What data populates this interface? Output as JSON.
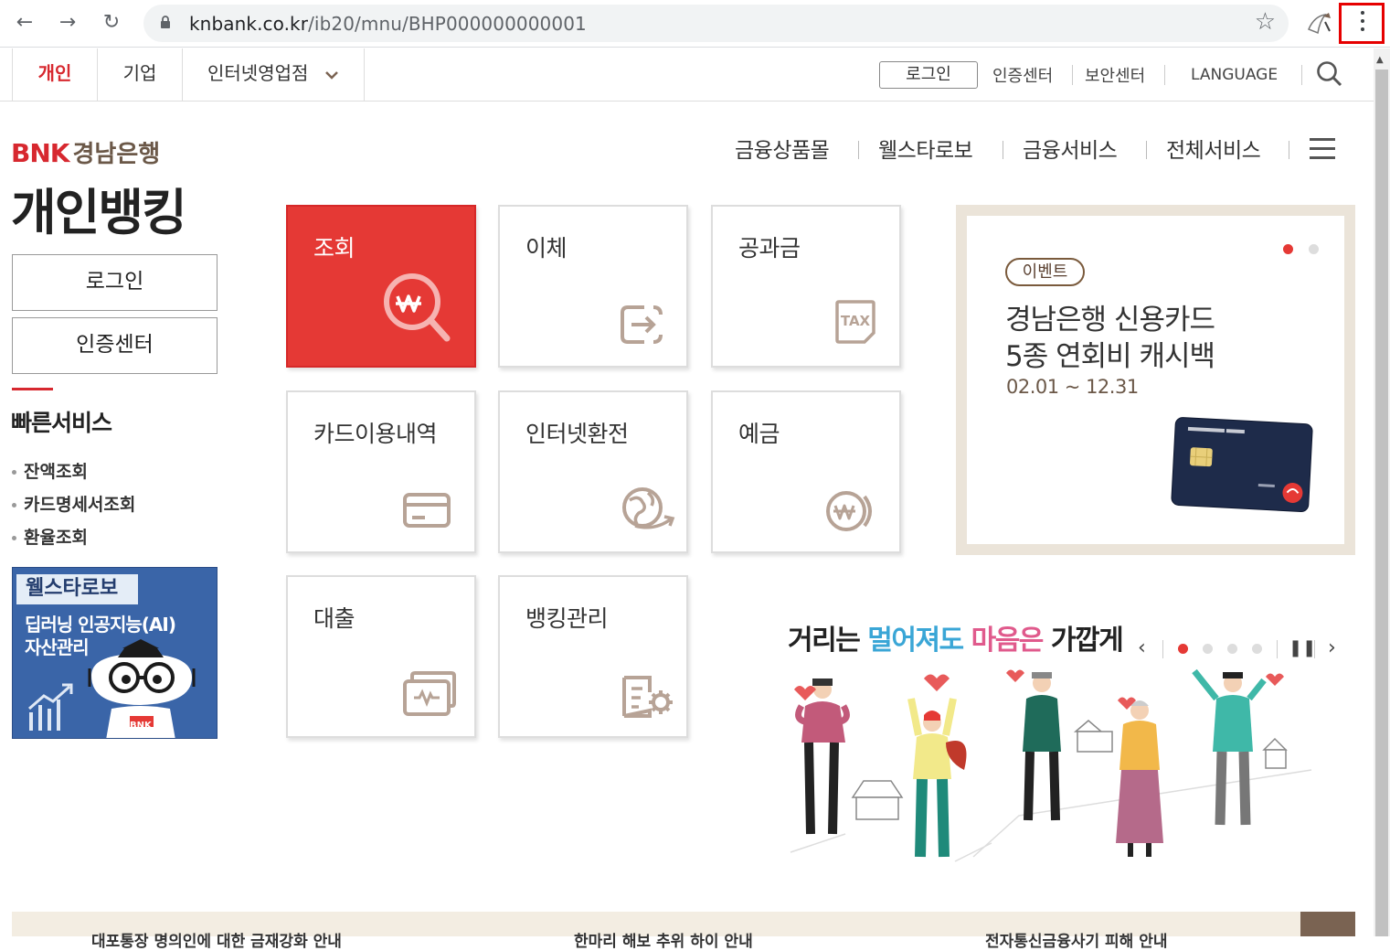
{
  "browser": {
    "url_host": "knbank.co.kr",
    "url_path": "/ib20/mnu/BHP000000000001"
  },
  "topnav": {
    "tabs": [
      {
        "label": "개인"
      },
      {
        "label": "기업"
      },
      {
        "label": "인터넷영업점"
      }
    ],
    "login": "로그인",
    "cert": "인증센터",
    "security": "보안센터",
    "language": "LANGUAGE"
  },
  "logo": {
    "bnk": "BNK",
    "name": "경남은행"
  },
  "page_title": "개인뱅킹",
  "side": {
    "login_button": "로그인",
    "cert_button": "인증센터",
    "quick_title": "빠른서비스",
    "quick_items": [
      "잔액조회",
      "카드명세서조회",
      "환율조회"
    ],
    "robo_tag": "웰스타로보",
    "robo_line1": "딥러닝 인공지능(AI)",
    "robo_line2": "자산관리",
    "robo_brand": "BNK"
  },
  "gnb": [
    "금융상품몰",
    "웰스타로보",
    "금융서비스",
    "전체서비스"
  ],
  "tiles": [
    {
      "label": "조회"
    },
    {
      "label": "이체"
    },
    {
      "label": "공과금"
    },
    {
      "label": "카드이용내역"
    },
    {
      "label": "인터넷환전"
    },
    {
      "label": "예금"
    },
    {
      "label": "대출"
    },
    {
      "label": "뱅킹관리"
    }
  ],
  "tax_icon_text": "TAX",
  "event": {
    "tag": "이벤트",
    "title1": "경남은행 신용카드",
    "title2": "5종 연회비 캐시백",
    "date": "02.01 ~ 12.31"
  },
  "campaign": {
    "part1": "거리는 ",
    "part2": "멀어져도",
    "part3": " ",
    "part4": "마음은",
    "part5": " 가깝게"
  },
  "bottom": [
    "대포통장 명의인에 대한 금재강화 안내",
    "한마리 해보 추위 하이 안내",
    "전자통신금융사기 피해 안내"
  ],
  "colors": {
    "brand_red": "#d7282f",
    "tile_red": "#e53935",
    "brown": "#6b5848"
  }
}
